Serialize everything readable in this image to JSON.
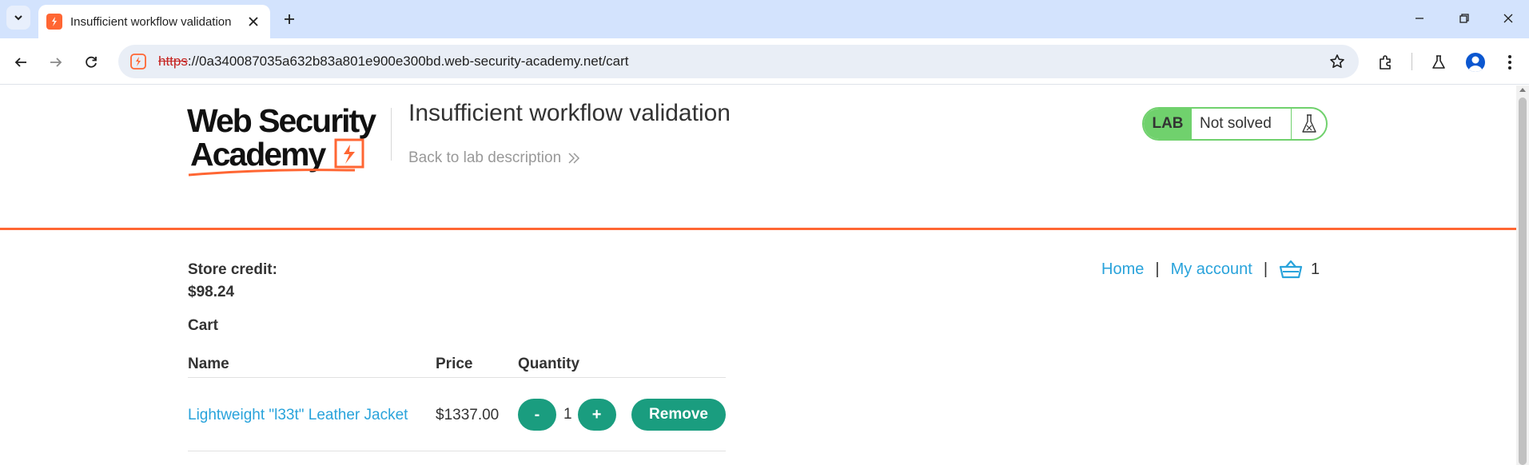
{
  "browser": {
    "tab_title": "Insufficient workflow validation",
    "url_scheme": "https",
    "url_rest": "://0a340087035a632b83a801e900e300bd.web-security-academy.net/cart",
    "accent": "#ff6633"
  },
  "header": {
    "logo_line1": "Web Security",
    "logo_line2": "Academy",
    "lab_title": "Insufficient workflow validation",
    "back_link": "Back to lab description",
    "lab_badge": "LAB",
    "lab_state": "Not solved",
    "status_color": "#70d16d"
  },
  "account": {
    "store_credit_label": "Store credit:",
    "store_credit_value": "$98.24",
    "cart_heading": "Cart"
  },
  "nav": {
    "home": "Home",
    "separator": "|",
    "my_account": "My account",
    "cart_count": "1"
  },
  "cart": {
    "columns": [
      "Name",
      "Price",
      "Quantity"
    ],
    "items": [
      {
        "name": "Lightweight \"l33t\" Leather Jacket",
        "price": "$1337.00",
        "quantity": "1",
        "decrement": "-",
        "increment": "+",
        "remove": "Remove"
      }
    ],
    "button_color": "#1a9d7f",
    "link_color": "#29a3db"
  }
}
